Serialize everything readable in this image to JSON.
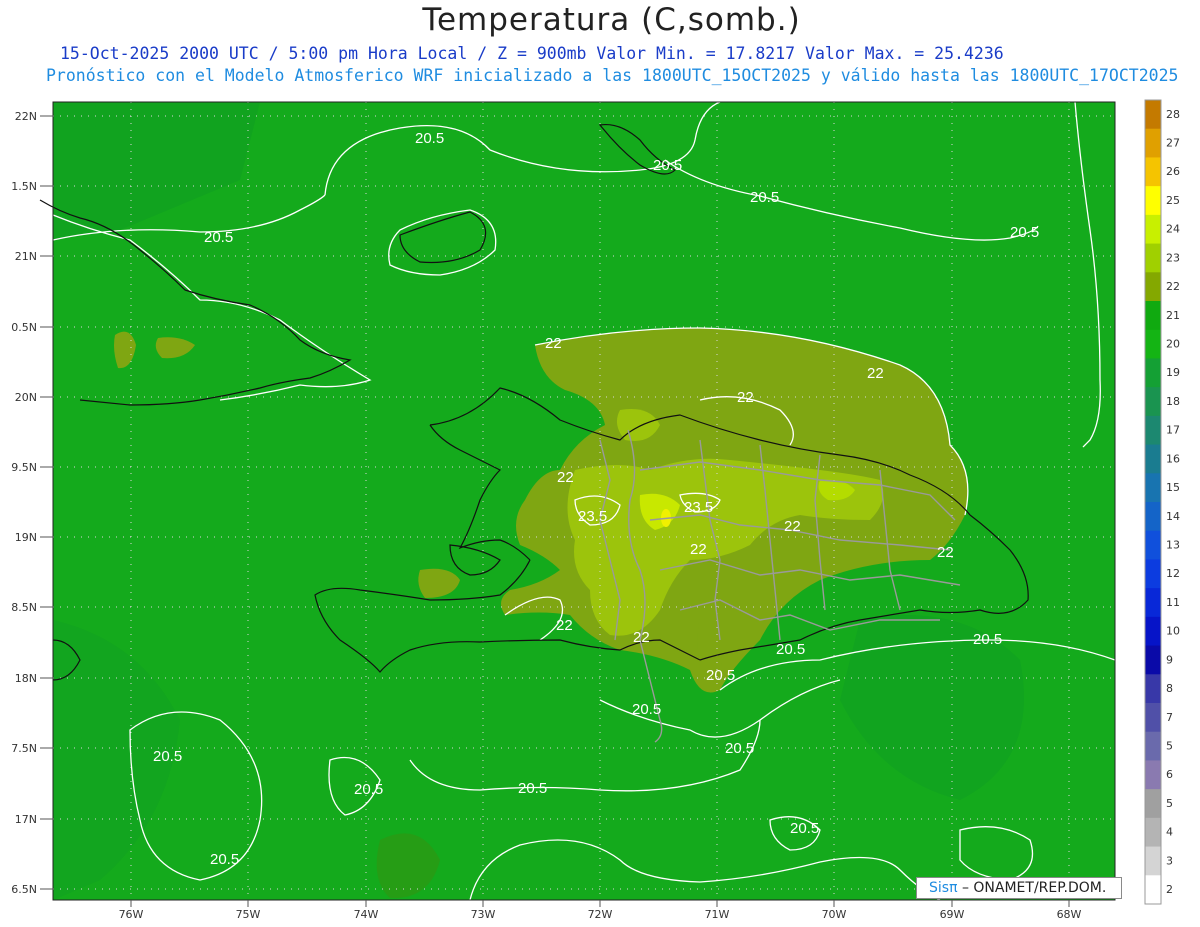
{
  "title": "Temperatura (C,somb.)",
  "subtitle_line1": "15-Oct-2025  2000 UTC / 5:00 pm Hora Local / Z = 900mb   Valor Min. = 17.8217  Valor Max. = 25.4236",
  "subtitle_line2": "Pronóstico con el Modelo Atmosferico WRF inicializado a las 1800UTC_15OCT2025 y válido hasta las  1800UTC_17OCT2025",
  "watermark": {
    "brand": "Sisπ",
    "text": "– ONAMET/REP.DOM."
  },
  "axes": {
    "lat_labels": [
      "22N",
      "1.5N",
      "21N",
      "0.5N",
      "20N",
      "9.5N",
      "19N",
      "8.5N",
      "18N",
      "7.5N",
      "17N",
      "6.5N"
    ],
    "lon_labels": [
      "76W",
      "75W",
      "74W",
      "73W",
      "72W",
      "71W",
      "70W",
      "69W",
      "68W"
    ]
  },
  "colorbar": {
    "labels": [
      "28",
      "27",
      "26",
      "25",
      "24",
      "23",
      "22",
      "21",
      "20",
      "19",
      "18",
      "17",
      "16",
      "15",
      "14",
      "13",
      "12",
      "11",
      "10",
      "9",
      "8",
      "7",
      "5",
      "6",
      "5",
      "4",
      "3",
      "2"
    ],
    "colors": [
      "#c47a00",
      "#e0a000",
      "#f5c400",
      "#ffff00",
      "#c8f000",
      "#a0d000",
      "#84a800",
      "#10aa10",
      "#14b414",
      "#14a034",
      "#1a9450",
      "#1c8870",
      "#1a7c90",
      "#1874b0",
      "#1464c8",
      "#1050dc",
      "#0c3ce0",
      "#0828d8",
      "#0614c8",
      "#0a0aa8",
      "#3838a8",
      "#5050a8",
      "#6a6aac",
      "#8a7ab0",
      "#a0a0a0",
      "#b4b4b4",
      "#d4d4d4",
      "#ffffff"
    ]
  },
  "contour_labels": [
    {
      "text": "20.5"
    },
    {
      "text": "20.5"
    },
    {
      "text": "20.5"
    },
    {
      "text": "20.5"
    },
    {
      "text": "20.5"
    },
    {
      "text": "22"
    },
    {
      "text": "22"
    },
    {
      "text": "22"
    },
    {
      "text": "22"
    },
    {
      "text": "23.5"
    },
    {
      "text": "23.5"
    },
    {
      "text": "22"
    },
    {
      "text": "22"
    },
    {
      "text": "22"
    },
    {
      "text": "22"
    },
    {
      "text": "22"
    },
    {
      "text": "20.5"
    },
    {
      "text": "20.5"
    },
    {
      "text": "20.5"
    },
    {
      "text": "20.5"
    },
    {
      "text": "20.5"
    },
    {
      "text": "20.5"
    },
    {
      "text": "20.5"
    },
    {
      "text": "20.5"
    },
    {
      "text": "20.5"
    },
    {
      "text": "20.5"
    }
  ],
  "colors": {
    "field_base": "#14aa1c",
    "field_dark": "#0f9a26",
    "warm_22": "#7fa612",
    "warm_23": "#9cc40c",
    "warm_24": "#c8e800",
    "warm_25": "#f0f000",
    "contour": "#ffffff",
    "coast": "#111111",
    "border_admin": "#9a9a9a",
    "grid": "#d8d8d8"
  }
}
